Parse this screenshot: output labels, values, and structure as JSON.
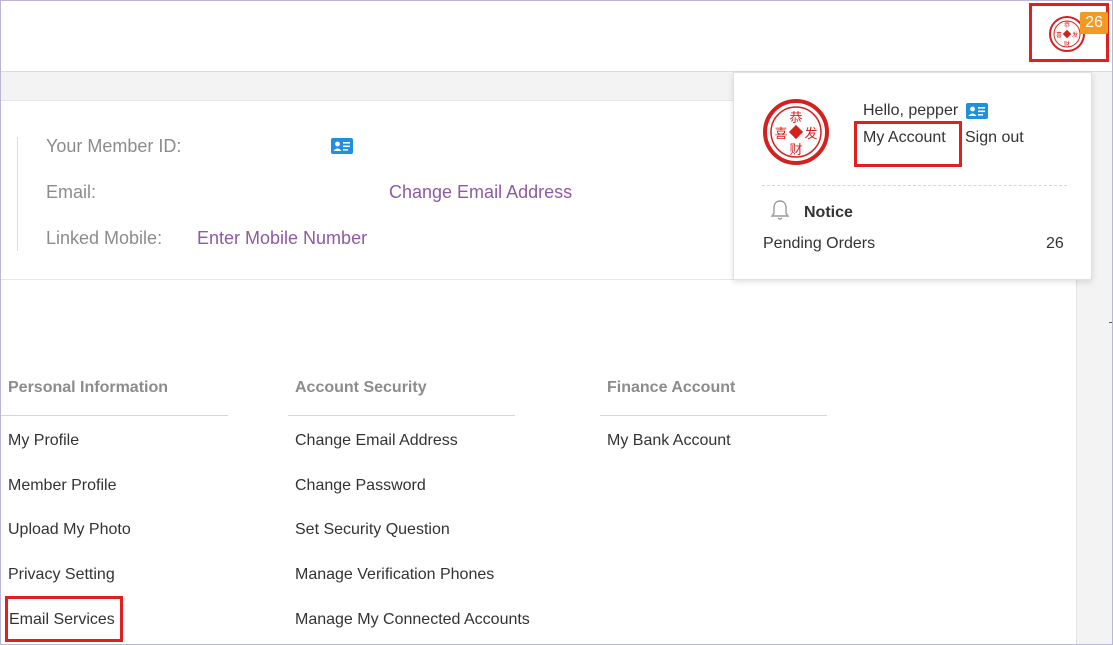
{
  "header": {
    "notification_count": "26",
    "avatar_text": "恭喜发财"
  },
  "member_info": {
    "member_id_label": "Your Member ID:",
    "email_label": "Email:",
    "change_email_link": "Change Email Address",
    "linked_mobile_label": "Linked Mobile:",
    "enter_mobile_link": "Enter Mobile Number"
  },
  "columns": {
    "personal": {
      "heading": "Personal Information",
      "items": [
        "My Profile",
        "Member Profile",
        "Upload My Photo",
        "Privacy Setting",
        "Email Services"
      ]
    },
    "security": {
      "heading": "Account Security",
      "items": [
        "Change Email Address",
        "Change Password",
        "Set Security Question",
        "Manage Verification Phones",
        "Manage My Connected Accounts"
      ]
    },
    "finance": {
      "heading": "Finance Account",
      "items": [
        "My Bank Account"
      ]
    }
  },
  "dropdown": {
    "greeting": "Hello, pepper",
    "my_account": "My Account",
    "sign_out": "Sign out",
    "notice_title": "Notice",
    "pending_orders_label": "Pending Orders",
    "pending_orders_count": "26"
  },
  "colors": {
    "highlight_red": "#e0201e",
    "badge_orange": "#f39a23",
    "link_purple": "#8e5aa3",
    "id_icon_blue": "#1f8fe0"
  }
}
